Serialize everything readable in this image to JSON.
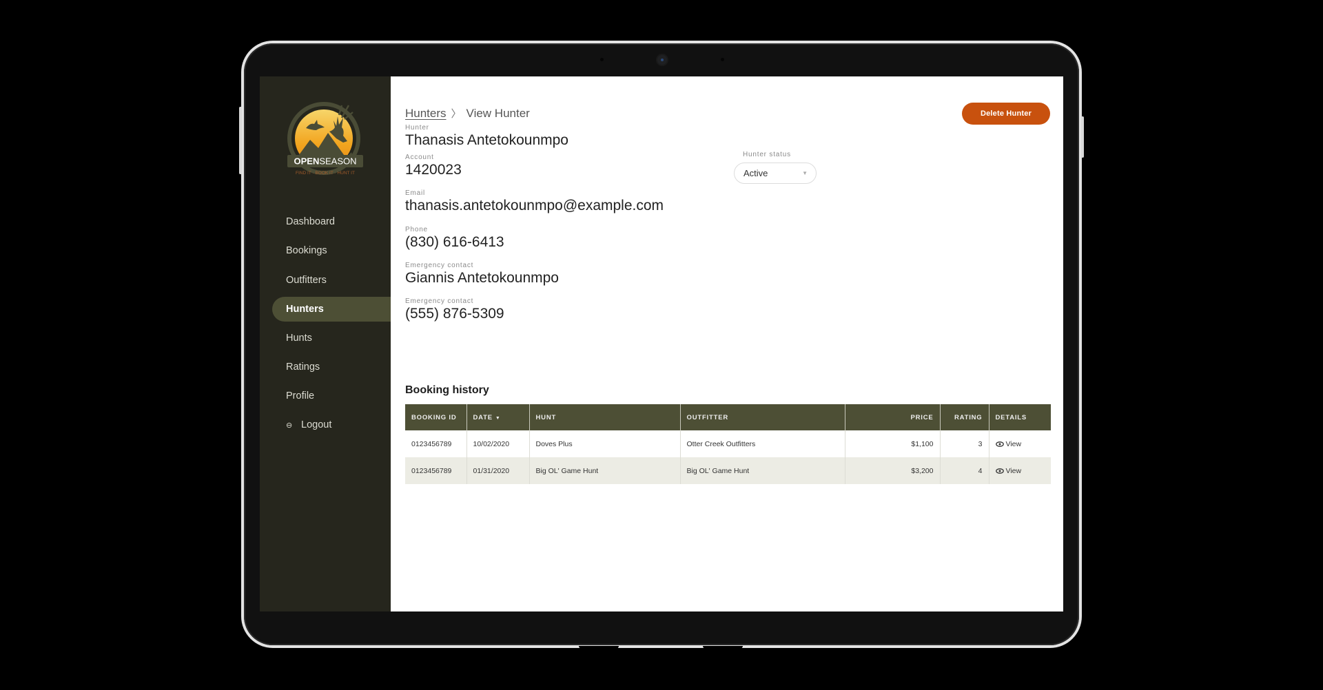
{
  "brand": {
    "name_bold": "OPEN",
    "name_light": "SEASON",
    "tagline": "FIND IT · BOOK IT · HUNT IT",
    "colors": {
      "sidebar": "#26261d",
      "accent_olive": "#4d4f35",
      "danger": "#c8510e",
      "sun": "#f2a51f"
    }
  },
  "sidebar": {
    "items": [
      {
        "label": "Dashboard",
        "active": false
      },
      {
        "label": "Bookings",
        "active": false
      },
      {
        "label": "Outfitters",
        "active": false
      },
      {
        "label": "Hunters",
        "active": true
      },
      {
        "label": "Hunts",
        "active": false
      },
      {
        "label": "Ratings",
        "active": false
      },
      {
        "label": "Profile",
        "active": false
      },
      {
        "label": "Logout",
        "icon": "logout-icon",
        "active": false
      }
    ]
  },
  "breadcrumb": {
    "parent": "Hunters",
    "separator": "〉",
    "current": "View Hunter"
  },
  "actions": {
    "delete_label": "Delete Hunter"
  },
  "hunter": {
    "fields": [
      {
        "label": "Hunter",
        "value": "Thanasis Antetokounmpo"
      },
      {
        "label": "Account",
        "value": "1420023"
      },
      {
        "label": "Email",
        "value": "thanasis.antetokounmpo@example.com"
      },
      {
        "label": "Phone",
        "value": "(830) 616-6413"
      },
      {
        "label": "Emergency contact",
        "value": "Giannis Antetokounmpo"
      },
      {
        "label": "Emergency contact",
        "value": "(555) 876-5309"
      }
    ],
    "status": {
      "label": "Hunter status",
      "value": "Active"
    }
  },
  "booking_history": {
    "title": "Booking history",
    "columns": [
      "BOOKING ID",
      "DATE",
      "HUNT",
      "OUTFITTER",
      "PRICE",
      "RATING",
      "DETAILS"
    ],
    "sort": {
      "column": "DATE",
      "direction": "desc"
    },
    "rows": [
      {
        "booking_id": "0123456789",
        "date": "10/02/2020",
        "hunt": "Doves Plus",
        "outfitter": "Otter Creek Outfitters",
        "price": "$1,100",
        "rating": "3",
        "details": "View"
      },
      {
        "booking_id": "0123456789",
        "date": "01/31/2020",
        "hunt": "Big OL' Game Hunt",
        "outfitter": "Big OL' Game Hunt",
        "price": "$3,200",
        "rating": "4",
        "details": "View"
      }
    ]
  }
}
